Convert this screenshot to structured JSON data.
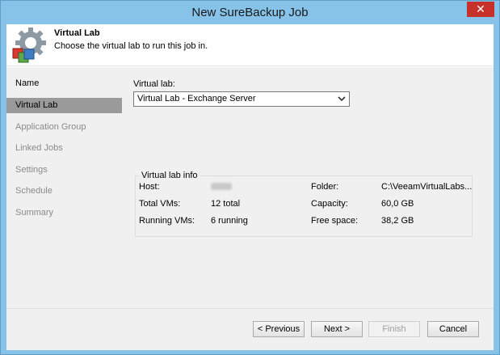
{
  "window": {
    "title": "New SureBackup Job",
    "close_glyph": "✕"
  },
  "header": {
    "title": "Virtual Lab",
    "description": "Choose the virtual lab to run this job in.",
    "icon": "gear-cubes-icon"
  },
  "steps": [
    {
      "label": "Name",
      "state": "done"
    },
    {
      "label": "Virtual Lab",
      "state": "active"
    },
    {
      "label": "Application Group",
      "state": "pending"
    },
    {
      "label": "Linked Jobs",
      "state": "pending"
    },
    {
      "label": "Settings",
      "state": "pending"
    },
    {
      "label": "Schedule",
      "state": "pending"
    },
    {
      "label": "Summary",
      "state": "pending"
    }
  ],
  "main": {
    "virtual_lab_label": "Virtual lab:",
    "virtual_lab_selected": "Virtual Lab - Exchange Server",
    "info": {
      "legend": "Virtual lab info",
      "host_label": "Host:",
      "host_value_redacted": true,
      "total_vms_label": "Total VMs:",
      "total_vms_value": "12 total",
      "running_vms_label": "Running VMs:",
      "running_vms_value": "6 running",
      "folder_label": "Folder:",
      "folder_value": "C:\\VeeamVirtualLabs...",
      "capacity_label": "Capacity:",
      "capacity_value": "60,0 GB",
      "free_space_label": "Free space:",
      "free_space_value": "38,2 GB"
    }
  },
  "footer": {
    "previous": "< Previous",
    "next": "Next >",
    "finish": "Finish",
    "cancel": "Cancel"
  }
}
